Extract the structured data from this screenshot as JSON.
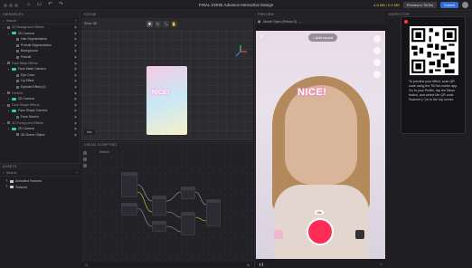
{
  "window": {
    "title": "FINAL DONE Advance Interactive Design"
  },
  "topbar": {
    "size_stat": "4.8 MB / 0.0 MB",
    "preview_btn": "Preview in TikTok",
    "submit_btn": "Submit"
  },
  "hierarchy": {
    "header": "HIERARCHY",
    "search": "Search",
    "items": [
      {
        "label": "2D Background Effects",
        "type": "group"
      },
      {
        "label": "2D Camera",
        "type": "camera"
      },
      {
        "label": "Hair Segmentation",
        "type": "item"
      },
      {
        "label": "Portrait Segmentation",
        "type": "item"
      },
      {
        "label": "Background",
        "type": "item"
      },
      {
        "label": "Portrait",
        "type": "item"
      },
      {
        "label": "Face Mask Effects",
        "type": "group"
      },
      {
        "label": "Face Mask Camera",
        "type": "camera"
      },
      {
        "label": "Eye Color",
        "type": "item"
      },
      {
        "label": "Lip Effect",
        "type": "item"
      },
      {
        "label": "Eyelash Effect (0)",
        "type": "item"
      },
      {
        "label": "Generic",
        "type": "group"
      },
      {
        "label": "3D Camera",
        "type": "camera"
      },
      {
        "label": "Face Shape Effects",
        "type": "group"
      },
      {
        "label": "Face Shape Camera",
        "type": "camera"
      },
      {
        "label": "Face Stretch",
        "type": "item"
      },
      {
        "label": "2D Foreground Effects",
        "type": "group"
      },
      {
        "label": "2D Camera",
        "type": "camera"
      },
      {
        "label": "3D Scene Object",
        "type": "item"
      }
    ]
  },
  "assets": {
    "header": "ASSETS",
    "search": "Search",
    "folders": [
      "Animated Textures",
      "Textures"
    ]
  },
  "scene": {
    "header": "SCENE",
    "view_label": "Show 3D",
    "info": "Info"
  },
  "visual_scripting": {
    "header": "VISUAL SCRIPTING",
    "search": "Search"
  },
  "preview": {
    "header": "PREVIEW",
    "device": "Mouth Open (Person 3)",
    "add_sound": "Add sound",
    "effect_text": "NICE!",
    "timer_badge": "15s"
  },
  "inspector": {
    "header": "INSPECTOR"
  },
  "qr_popup": {
    "text": "To preview your effect, scan QR code using the TikTok mobile app. Go to your Profile, tap the Menu button, and select Me QR code. Scanner [⌐] is in the top corner."
  }
}
